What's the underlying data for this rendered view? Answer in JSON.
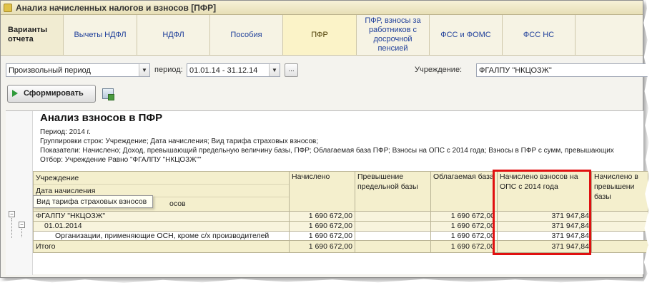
{
  "window": {
    "title": "Анализ начисленных налогов и взносов [ПФР]"
  },
  "variants": {
    "header": "Варианты отчета",
    "tabs": [
      {
        "label": "Вычеты НДФЛ"
      },
      {
        "label": "НДФЛ"
      },
      {
        "label": "Пособия"
      },
      {
        "label": "ПФР"
      },
      {
        "label": "ПФР, взносы за работников с досрочной пенсией"
      },
      {
        "label": "ФСС  и ФОМС"
      },
      {
        "label": "ФСС НС"
      }
    ]
  },
  "params": {
    "period_type": "Произвольный период",
    "period_label": "период:",
    "period_value": "01.01.14 - 31.12.14",
    "dots": "...",
    "institution_label": "Учреждение:",
    "institution_value": "ФГАЛПУ \"НКЦОЗЖ\""
  },
  "actions": {
    "generate_label": "Сформировать"
  },
  "report": {
    "title": "Анализ взносов в ПФР",
    "period": "Период: 2014 г.",
    "grouping": "Группировки строк: Учреждение; Дата начисления; Вид тарифа страховых взносов;",
    "indicators": "Показатели: Начислено; Доход, превышающий предельную величину базы, ПФР; Облагаемая база ПФР; Взносы на ОПС с 2014 года; Взносы в ПФР с сумм, превышающих",
    "filter": "Отбор: Учреждение Равно \"ФГАЛПУ \"НКЦОЗЖ\"\"",
    "row_headers": [
      "Учреждение",
      "Дата начисления",
      "Вид тарифа страховых взносов"
    ],
    "row_header_visible_tail": "осов",
    "columns": [
      "Начислено",
      "Превышение предельной базы",
      "Облагаемая база",
      "Начислено взносов на ОПС с 2014 года",
      "Начислено в превышени базы"
    ],
    "rows": [
      {
        "label": "ФГАЛПУ \"НКЦОЗЖ\"",
        "accrued": "1 690 672,00",
        "excess": "",
        "base": "1 690 672,00",
        "ops": "371 947,84"
      },
      {
        "label": "01.01.2014",
        "accrued": "1 690 672,00",
        "excess": "",
        "base": "1 690 672,00",
        "ops": "371 947,84"
      },
      {
        "label": "Организации, применяющие ОСН, кроме с/х производителей",
        "accrued": "1 690 672,00",
        "excess": "",
        "base": "1 690 672,00",
        "ops": "371 947,84"
      }
    ],
    "total": {
      "label": "Итого",
      "accrued": "1 690 672,00",
      "excess": "",
      "base": "1 690 672,00",
      "ops": "371 947,84"
    }
  },
  "tooltip": "Вид тарифа страховых взносов",
  "colors": {
    "highlight": "#e01010",
    "header_bg": "#f4efcd",
    "link": "#1f3f9a"
  }
}
